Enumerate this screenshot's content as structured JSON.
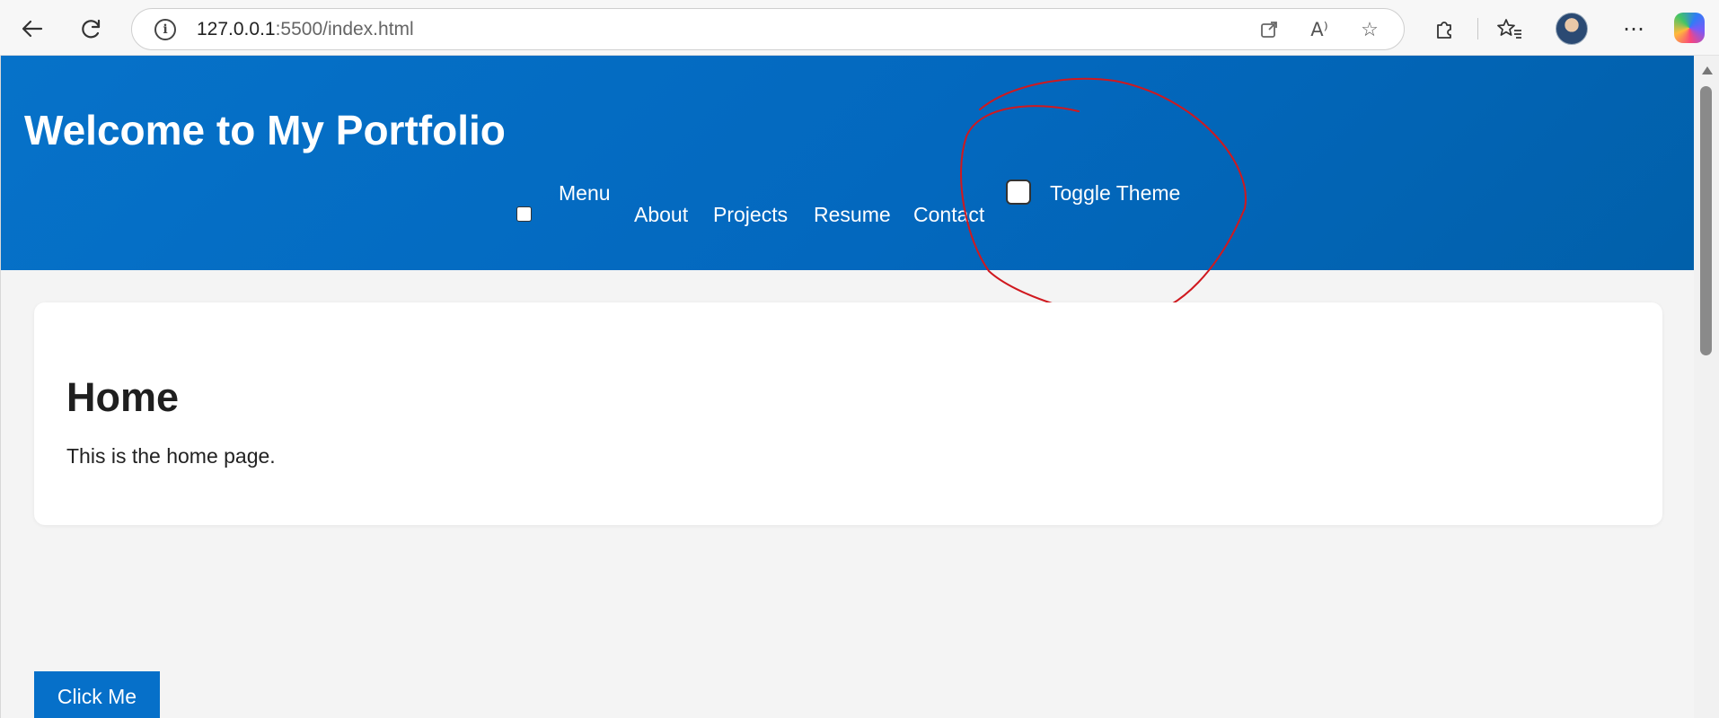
{
  "browser": {
    "url_host": "127.0.0.1",
    "url_rest": ":5500/index.html"
  },
  "header": {
    "title": "Welcome to My Portfolio",
    "menu_label": "Menu",
    "nav": [
      {
        "label": "About"
      },
      {
        "label": "Projects"
      },
      {
        "label": "Resume"
      },
      {
        "label": "Contact"
      }
    ],
    "toggle_label": "Toggle Theme"
  },
  "main": {
    "heading": "Home",
    "text": "This is the home page."
  },
  "cta": {
    "label": "Click Me"
  },
  "colors": {
    "header_bg": "#0369be",
    "button_bg": "#0670c9",
    "annotation": "#d0191f"
  }
}
